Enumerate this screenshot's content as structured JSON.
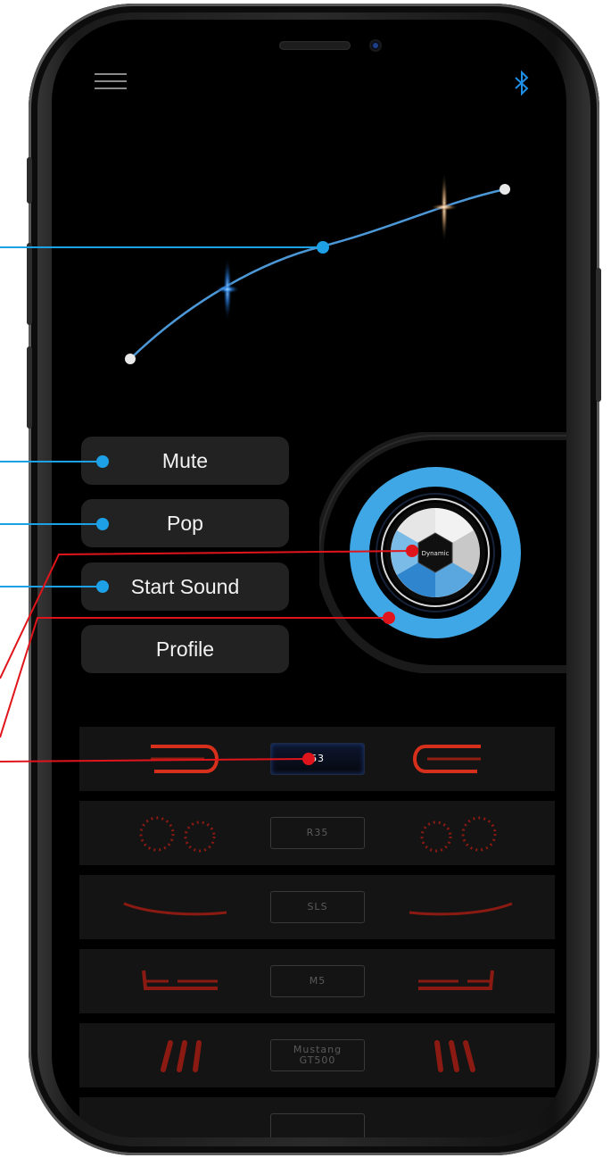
{
  "buttons": {
    "mute": "Mute",
    "pop": "Pop",
    "start_sound": "Start Sound",
    "profile": "Profile"
  },
  "dial": {
    "label": "Dynamic"
  },
  "sound_profiles": [
    {
      "label": "63",
      "active": true
    },
    {
      "label": "R35",
      "active": false
    },
    {
      "label": "SLS",
      "active": false
    },
    {
      "label": "M5",
      "active": false
    },
    {
      "label_line1": "Mustang",
      "label_line2": "GT500",
      "active": false
    }
  ],
  "icons": {
    "menu": "hamburger-menu-icon",
    "bluetooth": "bluetooth-icon"
  },
  "colors": {
    "background": "#000000",
    "button": "#222222",
    "callout_blue": "#1ea0e6",
    "callout_red": "#e0151b",
    "dial_blue": "#3fa7e6",
    "taillight_red": "#d4241a"
  }
}
